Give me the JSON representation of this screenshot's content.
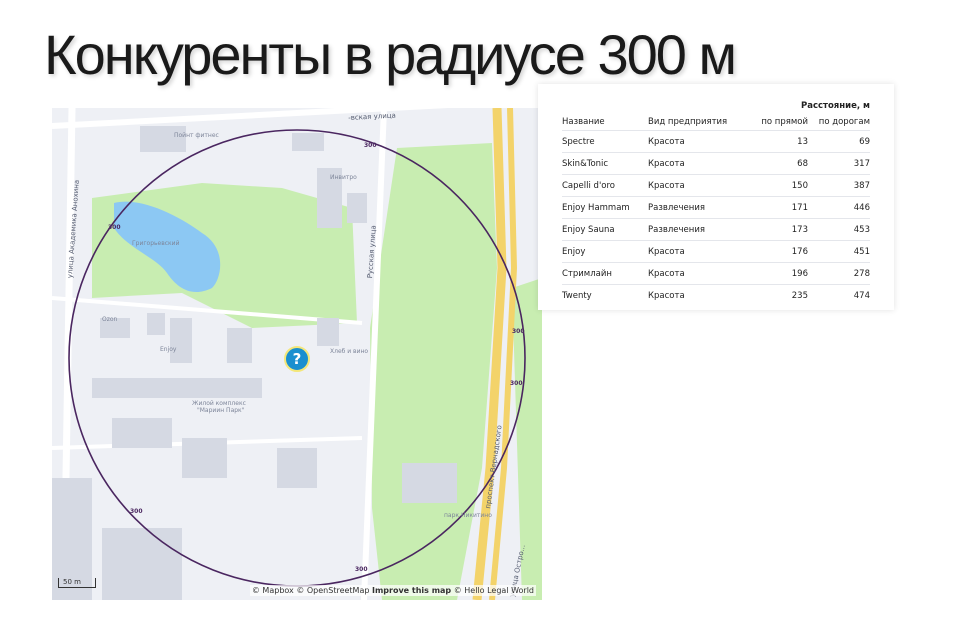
{
  "title": "Конкуренты в радиусе 300 м",
  "map": {
    "labels": {
      "pointfitness": "Пойнт фитнес",
      "grigor": "Григорьевский",
      "invitro": "Инвитро",
      "ozon": "Ozon",
      "enjoy": "Enjoy",
      "hleb": "Хлеб и вино",
      "complex_1": "Жилой комплекс",
      "complex_2": "\"Мариин Парк\"",
      "park": "парк Никитино"
    },
    "streets": {
      "akad": "улица Академика Анохина",
      "russkaya": "Русская улица",
      "top": "-вская улица",
      "prospekt": "проспект Вернадского",
      "ostro": "улица Остро..."
    },
    "ring_label": "300",
    "scale": "50 m",
    "attribution": {
      "mapbox": "© Mapbox",
      "osm": "© OpenStreetMap",
      "improve": "Improve this map",
      "hello": "© Hello Legal World"
    },
    "marker_symbol": "?",
    "colors": {
      "ring": "#4a2660",
      "park": "#c8edb1",
      "water": "#8cc8f3",
      "road": "#f3d36a",
      "marker": "#1a8fcf"
    }
  },
  "table": {
    "group_header": "Расстояние, м",
    "headers": [
      "Название",
      "Вид предприятия",
      "по прямой",
      "по дорогам"
    ],
    "rows": [
      [
        "Spectre",
        "Красота",
        "13",
        "69"
      ],
      [
        "Skin&Tonic",
        "Красота",
        "68",
        "317"
      ],
      [
        "Capelli d'oro",
        "Красота",
        "150",
        "387"
      ],
      [
        "Enjoy Hammam",
        "Развлечения",
        "171",
        "446"
      ],
      [
        "Enjoy Sauna",
        "Развлечения",
        "173",
        "453"
      ],
      [
        "Enjoy",
        "Красота",
        "176",
        "451"
      ],
      [
        "Стримлайн",
        "Красота",
        "196",
        "278"
      ],
      [
        "Twenty",
        "Красота",
        "235",
        "474"
      ]
    ]
  }
}
